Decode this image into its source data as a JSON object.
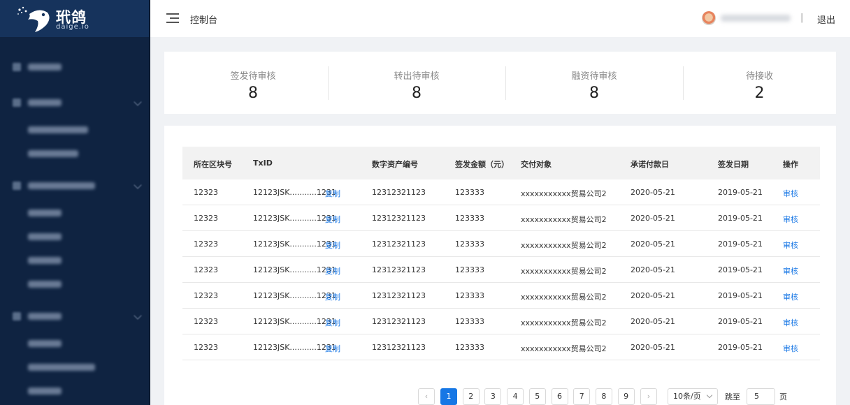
{
  "brand": {
    "name": "玳鸽",
    "subtitle": "daige.io"
  },
  "header": {
    "breadcrumb": "控制台",
    "separator": "|",
    "logout": "退出"
  },
  "stats": [
    {
      "label": "签发待审核",
      "value": "8"
    },
    {
      "label": "转出待审核",
      "value": "8"
    },
    {
      "label": "融资待审核",
      "value": "8"
    },
    {
      "label": "待接收",
      "value": "2"
    }
  ],
  "table": {
    "columns": [
      "所在区块号",
      "TxID",
      "数字资产编号",
      "签发金额（元）",
      "交付对象",
      "承诺付款日",
      "签发日期",
      "操作"
    ],
    "copy_label": "复制",
    "action_label": "审核",
    "rows": [
      {
        "block": "12323",
        "txid": "12123JSK...........1231",
        "asset_no": "12312321123",
        "amount": "123333",
        "recipient": "xxxxxxxxxxx贸易公司2",
        "due_date": "2020-05-21",
        "issue_date": "2019-05-21"
      },
      {
        "block": "12323",
        "txid": "12123JSK...........1231",
        "asset_no": "12312321123",
        "amount": "123333",
        "recipient": "xxxxxxxxxxx贸易公司2",
        "due_date": "2020-05-21",
        "issue_date": "2019-05-21"
      },
      {
        "block": "12323",
        "txid": "12123JSK...........1231",
        "asset_no": "12312321123",
        "amount": "123333",
        "recipient": "xxxxxxxxxxx贸易公司2",
        "due_date": "2020-05-21",
        "issue_date": "2019-05-21"
      },
      {
        "block": "12323",
        "txid": "12123JSK...........1231",
        "asset_no": "12312321123",
        "amount": "123333",
        "recipient": "xxxxxxxxxxx贸易公司2",
        "due_date": "2020-05-21",
        "issue_date": "2019-05-21"
      },
      {
        "block": "12323",
        "txid": "12123JSK...........1231",
        "asset_no": "12312321123",
        "amount": "123333",
        "recipient": "xxxxxxxxxxx贸易公司2",
        "due_date": "2020-05-21",
        "issue_date": "2019-05-21"
      },
      {
        "block": "12323",
        "txid": "12123JSK...........1231",
        "asset_no": "12312321123",
        "amount": "123333",
        "recipient": "xxxxxxxxxxx贸易公司2",
        "due_date": "2020-05-21",
        "issue_date": "2019-05-21"
      },
      {
        "block": "12323",
        "txid": "12123JSK...........1231",
        "asset_no": "12312321123",
        "amount": "123333",
        "recipient": "xxxxxxxxxxx贸易公司2",
        "due_date": "2020-05-21",
        "issue_date": "2019-05-21"
      }
    ]
  },
  "pagination": {
    "prev": "‹",
    "next": "›",
    "pages": [
      "1",
      "2",
      "3",
      "4",
      "5",
      "6",
      "7",
      "8",
      "9"
    ],
    "current_page": 1,
    "page_size": "10条/页",
    "jump_label": "跳至",
    "jump_value": "5",
    "page_unit": "页"
  },
  "colors": {
    "sidebar_bg": "#0f2341",
    "logo_bg": "#16335c",
    "accent": "#1677e5",
    "link": "#1d7ae6"
  }
}
